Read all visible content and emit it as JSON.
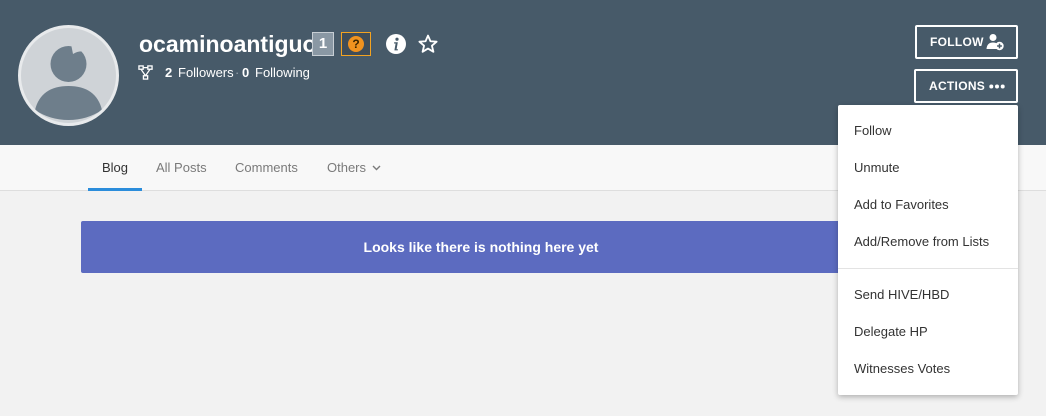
{
  "profile": {
    "username": "ocaminoantiguo",
    "reputation": "1",
    "help_badge": "?",
    "followers_count": "2",
    "followers_label": "Followers",
    "separator": "·",
    "following_count": "0",
    "following_label": "Following"
  },
  "buttons": {
    "follow_label": "FOLLOW",
    "actions_label": "ACTIONS"
  },
  "tabs": [
    {
      "label": "Blog",
      "active": true
    },
    {
      "label": "All Posts",
      "active": false
    },
    {
      "label": "Comments",
      "active": false
    },
    {
      "label": "Others",
      "active": false
    }
  ],
  "empty_message": "Looks like there is nothing here yet",
  "actions_menu": {
    "group1": [
      "Follow",
      "Unmute",
      "Add to Favorites",
      "Add/Remove from Lists"
    ],
    "group2": [
      "Send HIVE/HBD",
      "Delegate HP",
      "Witnesses Votes"
    ]
  },
  "colors": {
    "header_bg": "#475a69",
    "banner_bg": "#5c6bc0",
    "active_tab_underline": "#2b8ddb",
    "help_badge_border": "#f3a321"
  },
  "icons": {
    "info": "info-circle-icon",
    "favorite": "star-outline-icon",
    "network": "network-icon",
    "add_user": "person-add-icon",
    "more": "more-horiz-icon",
    "chevron": "chevron-down-icon"
  }
}
